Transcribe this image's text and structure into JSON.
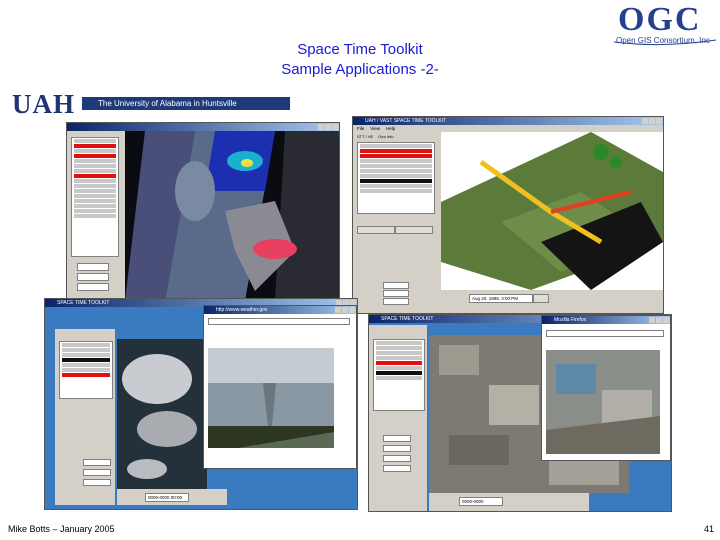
{
  "slide": {
    "title_line1": "Space Time Toolkit",
    "title_line2": "Sample Applications -2-",
    "footer": "Mike Botts – January 2005",
    "page_number": "41"
  },
  "logos": {
    "ogc_text": "OGC",
    "ogc_subtitle": "Open GIS Consortium, Inc",
    "uah_text": "UAH",
    "uah_banner": "The University of Alabama in Huntsville"
  },
  "colors": {
    "title": "#1a1ad0",
    "ogc_blue": "#24408e",
    "uah_blue": "#1f3470",
    "window_gray": "#d4d0c8",
    "list_highlight": "#e01010"
  },
  "screenshots": {
    "hurricane": {
      "title": ""
    },
    "terrain3d": {
      "title": "UAH / VAST SPACE TIME TOOLKIT",
      "tabs": [
        "STT / VE",
        "Geo Info"
      ],
      "time_label": "Aug 20, 1998, 3:00 PM"
    },
    "tornado": {
      "title": "SPACE TIME TOOLKIT",
      "browser_title": "http://www.weather.gov",
      "time_label": "0000-0000 00:00"
    },
    "damage": {
      "title": "SPACE TIME TOOLKIT",
      "browser_title": "Mozilla Firefox",
      "time_label": "0000-0000"
    }
  }
}
